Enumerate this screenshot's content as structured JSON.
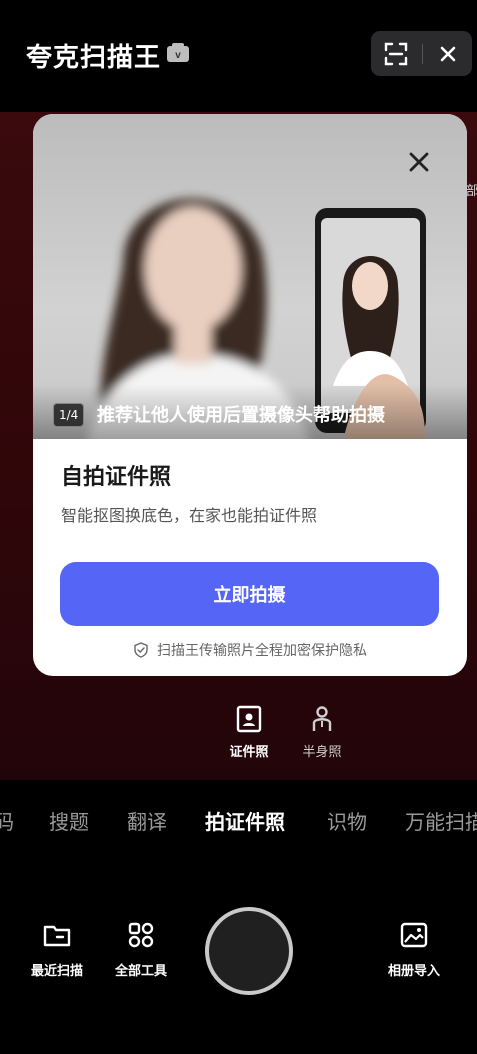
{
  "header": {
    "app_title": "夸克扫描王",
    "vip_badge_text": "v"
  },
  "side_hint": "部",
  "promo_card": {
    "page_indicator": "1/4",
    "hero_caption": "推荐让他人使用后置摄像头帮助拍摄",
    "title": "自拍证件照",
    "subtitle": "智能抠图换底色，在家也能拍证件照",
    "cta_label": "立即拍摄",
    "privacy_text": "扫描王传输照片全程加密保护隐私"
  },
  "modes": [
    {
      "label": "证件照",
      "selected": true
    },
    {
      "label": "半身照",
      "selected": false
    }
  ],
  "tabs": [
    {
      "label": "码"
    },
    {
      "label": "搜题"
    },
    {
      "label": "翻译"
    },
    {
      "label": "拍证件照",
      "active": true
    },
    {
      "label": "识物"
    },
    {
      "label": "万能扫描"
    }
  ],
  "bottom_bar": {
    "recent_scans": "最近扫描",
    "all_tools": "全部工具",
    "album_import": "相册导入"
  },
  "colors": {
    "accent": "#5566f7",
    "background": "#000000",
    "camera_tint": "#3a0a0d"
  }
}
